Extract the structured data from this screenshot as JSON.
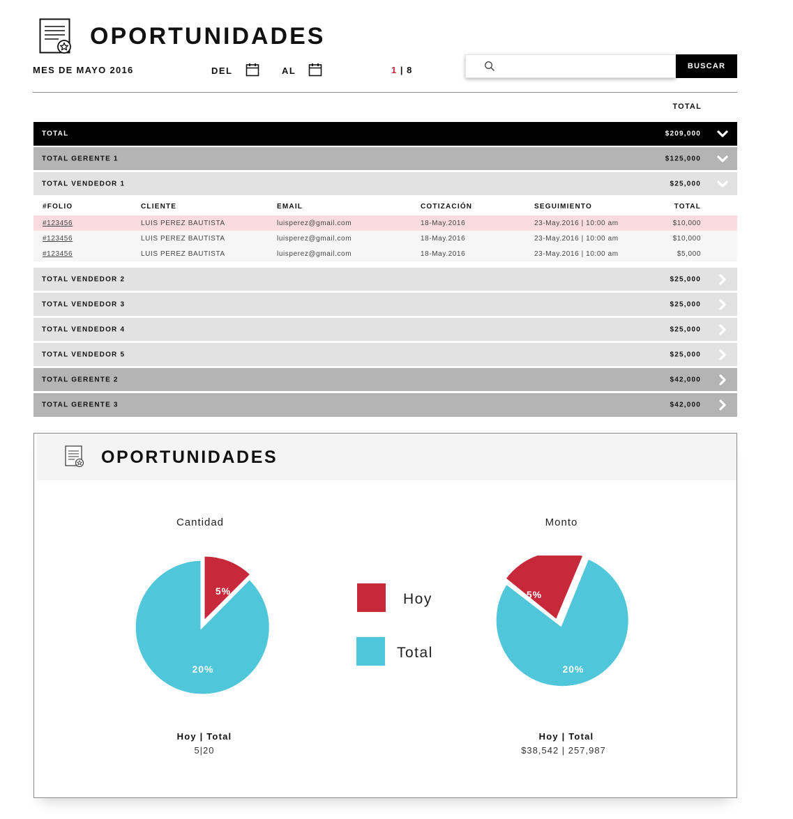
{
  "header": {
    "title": "OPORTUNIDADES",
    "period": "MES DE MAYO 2016",
    "from_label": "DEL",
    "to_label": "AL",
    "page_current": "1",
    "page_total": "8",
    "search_placeholder": "",
    "search_button": "BUSCAR",
    "total_column": "TOTAL"
  },
  "summary": {
    "total": {
      "label": "TOTAL",
      "amount": "$209,000"
    },
    "gerente1": {
      "label": "TOTAL GERENTE 1",
      "amount": "$125,000"
    },
    "vendedor1": {
      "label": "TOTAL VENDEDOR 1",
      "amount": "$25,000"
    },
    "vendedor2": {
      "label": "TOTAL VENDEDOR 2",
      "amount": "$25,000"
    },
    "vendedor3": {
      "label": "TOTAL VENDEDOR 3",
      "amount": "$25,000"
    },
    "vendedor4": {
      "label": "TOTAL VENDEDOR 4",
      "amount": "$25,000"
    },
    "vendedor5": {
      "label": "TOTAL VENDEDOR 5",
      "amount": "$25,000"
    },
    "gerente2": {
      "label": "TOTAL GERENTE 2",
      "amount": "$42,000"
    },
    "gerente3": {
      "label": "TOTAL GERENTE 3",
      "amount": "$42,000"
    }
  },
  "detail": {
    "columns": [
      "#FOLIO",
      "CLIENTE",
      "EMAIL",
      "COTIZACIÓN",
      "SEGUIMIENTO",
      "TOTAL"
    ],
    "rows": [
      {
        "folio": "#123456",
        "cliente": "LUIS PEREZ BAUTISTA",
        "email": "luisperez@gmail.com",
        "cotizacion": "18-May.2016",
        "seguimiento": "23-May.2016 | 10:00 am",
        "total": "$10,000"
      },
      {
        "folio": "#123456",
        "cliente": "LUIS PEREZ BAUTISTA",
        "email": "luisperez@gmail.com",
        "cotizacion": "18-May.2016",
        "seguimiento": "23-May.2016 | 10:00 am",
        "total": "$10,000"
      },
      {
        "folio": "#123456",
        "cliente": "LUIS PEREZ BAUTISTA",
        "email": "luisperez@gmail.com",
        "cotizacion": "18-May.2016",
        "seguimiento": "23-May.2016 | 10:00 am",
        "total": "$5,000"
      }
    ]
  },
  "panel": {
    "title": "OPORTUNIDADES",
    "legend": [
      {
        "label": "Hoy",
        "color": "#c8293a"
      },
      {
        "label": "Total",
        "color": "#4fc6d9"
      }
    ],
    "footer_head": "Hoy | Total",
    "cantidad_values": "5|20",
    "monto_values": "$38,542 | 257,987"
  },
  "colors": {
    "accent_red": "#c8293a",
    "accent_cyan": "#4fc6d9",
    "header_black": "#000000"
  },
  "icons": [
    "document-star-icon",
    "calendar-icon",
    "search-icon",
    "chevron-down-icon",
    "chevron-right-icon"
  ],
  "chart_data": [
    {
      "type": "pie",
      "title": "Cantidad",
      "labels": [
        "Hoy",
        "Total"
      ],
      "slice_labels": [
        "5%",
        "20%"
      ],
      "values": [
        5,
        20
      ],
      "colors": [
        "#c8293a",
        "#4fc6d9"
      ]
    },
    {
      "type": "pie",
      "title": "Monto",
      "labels": [
        "Hoy",
        "Total"
      ],
      "slice_labels": [
        "5%",
        "20%"
      ],
      "values": [
        38542,
        257987
      ],
      "colors": [
        "#c8293a",
        "#4fc6d9"
      ]
    }
  ]
}
